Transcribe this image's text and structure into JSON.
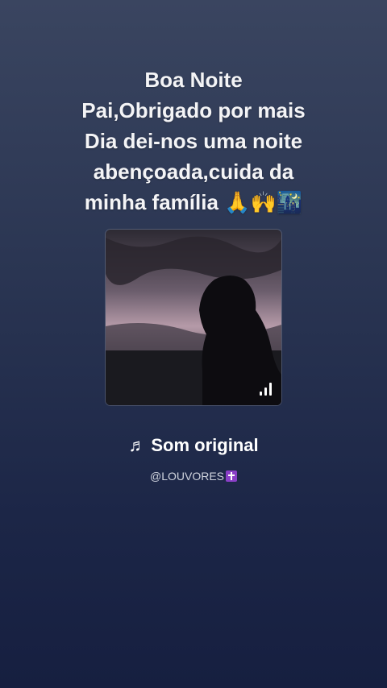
{
  "caption": {
    "text": "Boa Noite\nPai,Obrigado por mais\nDia dei-nos uma noite\nabençoada,cuida da\nminha família 🙏🙌🌃"
  },
  "album": {
    "image_desc_icon": "silhouette-cover",
    "playing_indicator_icon": "signal-bars-icon"
  },
  "sound": {
    "note_icon": "♬",
    "title": "Som original"
  },
  "author": {
    "handle": "@LOUVORES",
    "badge_icon": "latin-cross-icon"
  },
  "colors": {
    "background_top": "#3a4560",
    "background_bottom": "#161f40",
    "text": "#ffffff"
  }
}
